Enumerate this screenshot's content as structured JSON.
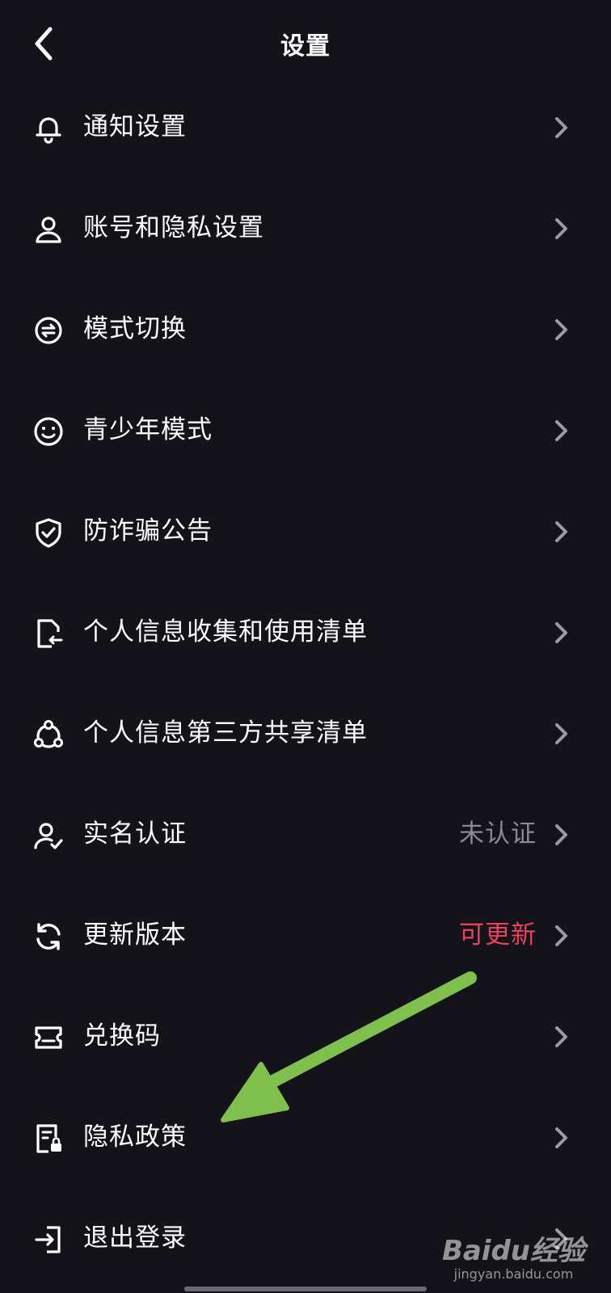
{
  "header": {
    "title": "设置"
  },
  "settings": [
    {
      "label": "通知设置",
      "icon": "bell-icon"
    },
    {
      "label": "账号和隐私设置",
      "icon": "person-icon"
    },
    {
      "label": "模式切换",
      "icon": "mode-switch-icon"
    },
    {
      "label": "青少年模式",
      "icon": "smiley-icon"
    },
    {
      "label": "防诈骗公告",
      "icon": "shield-check-icon"
    },
    {
      "label": "个人信息收集和使用清单",
      "icon": "document-return-icon"
    },
    {
      "label": "个人信息第三方共享清单",
      "icon": "share-nodes-icon"
    },
    {
      "label": "实名认证",
      "icon": "person-verified-icon",
      "value": "未认证"
    },
    {
      "label": "更新版本",
      "icon": "refresh-icon",
      "value": "可更新"
    },
    {
      "label": "兑换码",
      "icon": "ticket-icon"
    },
    {
      "label": "隐私政策",
      "icon": "document-lock-icon"
    },
    {
      "label": "退出登录",
      "icon": "logout-icon"
    }
  ],
  "colors": {
    "background": "#131319",
    "status_gray": "#8a8a91",
    "status_red": "#e8425f",
    "annotation_arrow": "#7fbf4d"
  },
  "watermark": {
    "logo_text": "Baidu经验",
    "site": "jingyan.baidu.com"
  }
}
